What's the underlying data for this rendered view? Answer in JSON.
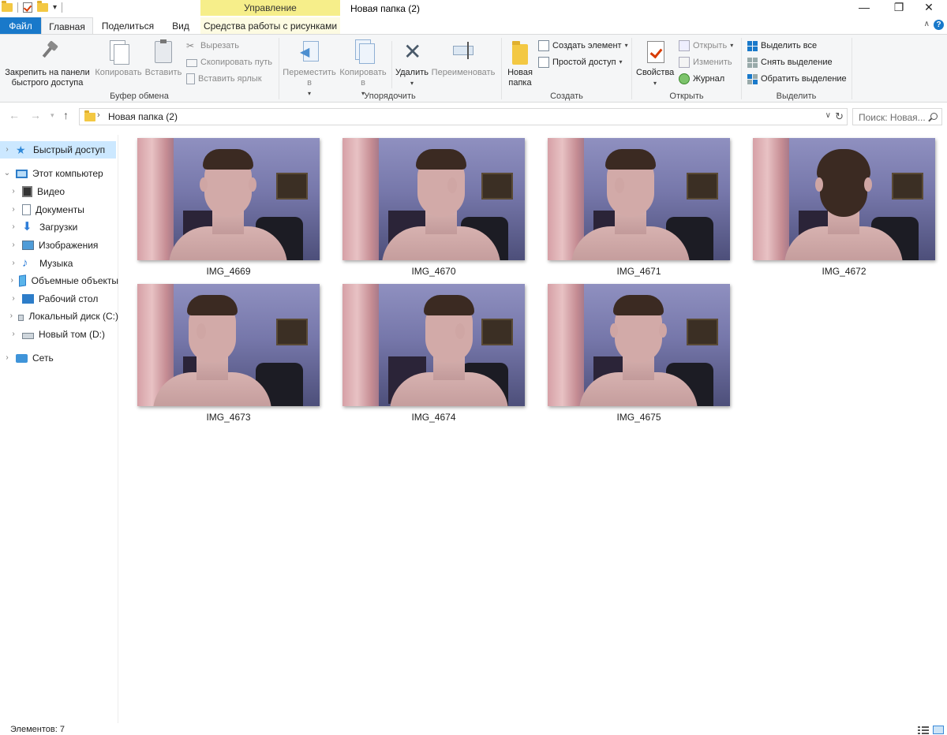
{
  "window": {
    "title": "Новая папка (2)",
    "context_tab_header": "Управление",
    "controls": {
      "minimize": "—",
      "restore": "❐",
      "close": "✕"
    }
  },
  "tabs": {
    "file": "Файл",
    "home": "Главная",
    "share": "Поделиться",
    "view": "Вид",
    "picture_tools": "Средства работы с рисунками",
    "collapse": "∧",
    "help": "?"
  },
  "ribbon": {
    "clipboard": {
      "label": "Буфер обмена",
      "pin": "Закрепить на панели быстрого доступа",
      "copy": "Копировать",
      "paste": "Вставить",
      "cut": "Вырезать",
      "copy_path": "Скопировать путь",
      "paste_shortcut": "Вставить ярлык"
    },
    "organize": {
      "label": "Упорядочить",
      "move_to": "Переместить в",
      "copy_to": "Копировать в",
      "delete": "Удалить",
      "rename": "Переименовать"
    },
    "create": {
      "label": "Создать",
      "new_folder": "Новая папка",
      "new_item": "Создать элемент",
      "easy_access": "Простой доступ"
    },
    "open": {
      "label": "Открыть",
      "properties": "Свойства",
      "open": "Открыть",
      "edit": "Изменить",
      "history": "Журнал"
    },
    "select": {
      "label": "Выделить",
      "select_all": "Выделить все",
      "select_none": "Снять выделение",
      "invert": "Обратить выделение"
    }
  },
  "address": {
    "path": "Новая папка (2)",
    "search_placeholder": "Поиск: Новая..."
  },
  "nav": {
    "quick_access": "Быстрый доступ",
    "this_pc": "Этот компьютер",
    "videos": "Видео",
    "documents": "Документы",
    "downloads": "Загрузки",
    "pictures": "Изображения",
    "music": "Музыка",
    "objects3d": "Объемные объекты",
    "desktop": "Рабочий стол",
    "local_disk": "Локальный диск (C:)",
    "new_volume": "Новый том (D:)",
    "network": "Сеть"
  },
  "files": [
    {
      "name": "IMG_4669",
      "pose": "front"
    },
    {
      "name": "IMG_4670",
      "pose": "right-profile"
    },
    {
      "name": "IMG_4671",
      "pose": "left-profile"
    },
    {
      "name": "IMG_4672",
      "pose": "back"
    },
    {
      "name": "IMG_4673",
      "pose": "three-quarter-right"
    },
    {
      "name": "IMG_4674",
      "pose": "three-quarter-left"
    },
    {
      "name": "IMG_4675",
      "pose": "head-down"
    }
  ],
  "status": {
    "count": "Элементов: 7"
  }
}
